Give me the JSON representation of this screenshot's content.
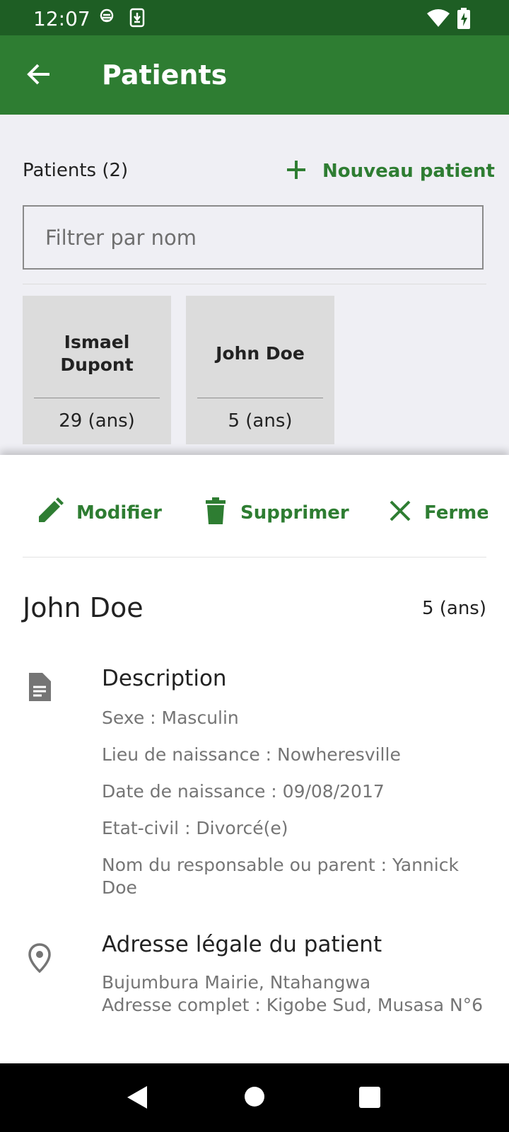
{
  "status_bar": {
    "time": "12:07"
  },
  "app_bar": {
    "title": "Patients"
  },
  "list": {
    "count_label": "Patients (2)",
    "new_patient_label": "Nouveau patient",
    "filter_placeholder": "Filtrer par nom",
    "patients": [
      {
        "name": "Ismael Dupont",
        "age": "29 (ans)"
      },
      {
        "name": "John Doe",
        "age": "5 (ans)"
      }
    ]
  },
  "detail": {
    "actions": {
      "edit": "Modifier",
      "delete": "Supprimer",
      "close": "Fermer"
    },
    "name": "John Doe",
    "age": "5 (ans)",
    "description": {
      "title": "Description",
      "lines": [
        "Sexe : Masculin",
        "Lieu de naissance : Nowheresville",
        "Date de naissance : 09/08/2017",
        "Etat-civil : Divorcé(e)",
        "Nom du responsable ou parent : Yannick Doe"
      ]
    },
    "address": {
      "title": "Adresse légale du patient",
      "lines": [
        "Bujumbura Mairie, Ntahangwa",
        "Adresse complet : Kigobe Sud, Musasa N°6"
      ]
    }
  },
  "colors": {
    "primary": "#2e7d32",
    "status_bar": "#1e5e24",
    "background": "#efeff4"
  },
  "icons": {
    "back": "arrow-back-icon",
    "add": "plus-icon",
    "edit": "pencil-icon",
    "delete": "trash-icon",
    "close": "close-icon",
    "description": "document-icon",
    "address": "location-pin-icon"
  }
}
